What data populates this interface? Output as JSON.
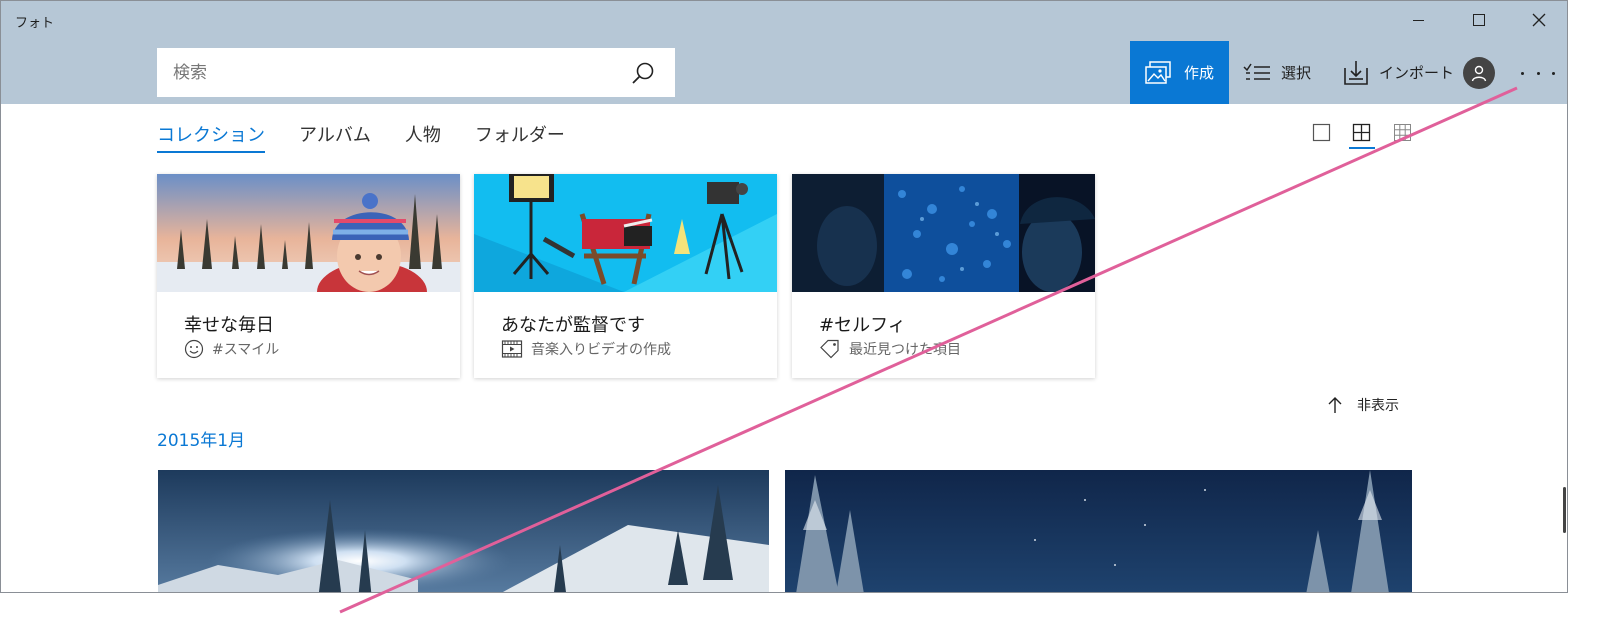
{
  "window": {
    "title": "フォト"
  },
  "controls": {
    "minimize": "minimize",
    "maximize": "maximize",
    "close": "close"
  },
  "search": {
    "placeholder": "検索",
    "value": ""
  },
  "toolbar": {
    "create_label": "作成",
    "select_label": "選択",
    "import_label": "インポート"
  },
  "tabs": [
    {
      "label": "コレクション",
      "active": true
    },
    {
      "label": "アルバム",
      "active": false
    },
    {
      "label": "人物",
      "active": false
    },
    {
      "label": "フォルダー",
      "active": false
    }
  ],
  "view_options": {
    "selected": "medium-grid"
  },
  "cards": [
    {
      "title": "幸せな毎日",
      "subtitle": "#スマイル",
      "icon": "smile-icon"
    },
    {
      "title": "あなたが監督です",
      "subtitle": "音楽入りビデオの作成",
      "icon": "video-editor-icon"
    },
    {
      "title": "#セルフィ",
      "subtitle": "最近見つけた項目",
      "icon": "tag-icon"
    }
  ],
  "hide_label": "非表示",
  "section_date": "2015年1月",
  "colors": {
    "accent": "#0a78d4",
    "header_bg": "#b6c7d6",
    "annotation_line": "#e0609a"
  }
}
